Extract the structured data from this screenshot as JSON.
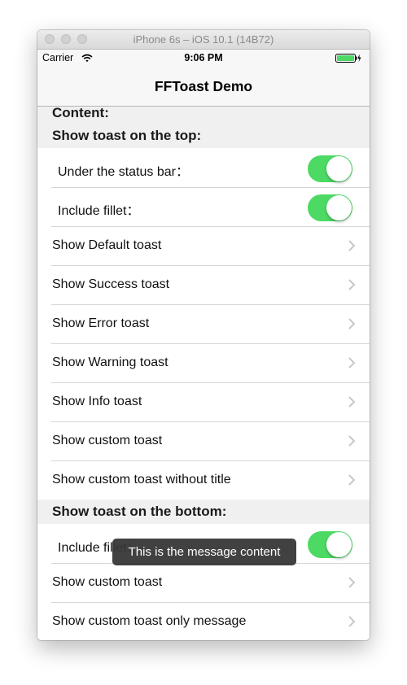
{
  "window": {
    "title": "iPhone 6s – iOS 10.1 (14B72)"
  },
  "statusbar": {
    "carrier": "Carrier",
    "time": "9:06 PM",
    "battery_color": "#4cd964"
  },
  "navbar": {
    "title": "FFToast Demo"
  },
  "content_label": "Content:",
  "sections": {
    "top": {
      "header": "Show toast on the top:",
      "switches": [
        {
          "label": "Under the status bar：",
          "on": true
        },
        {
          "label": "Include fillet：",
          "on": true
        }
      ],
      "items": [
        "Show Default toast",
        "Show Success toast",
        "Show Error toast",
        "Show Warning toast",
        "Show Info toast",
        "Show custom toast",
        "Show custom toast without title"
      ]
    },
    "bottom": {
      "header": "Show toast on the bottom:",
      "switches": [
        {
          "label": "Include fillet：",
          "on": true
        }
      ],
      "items": [
        "Show custom toast",
        "Show custom toast only message"
      ]
    }
  },
  "toast": {
    "message": "This is the message content"
  },
  "colors": {
    "switch_on": "#4cd964",
    "chevron": "#c7c7cc"
  }
}
